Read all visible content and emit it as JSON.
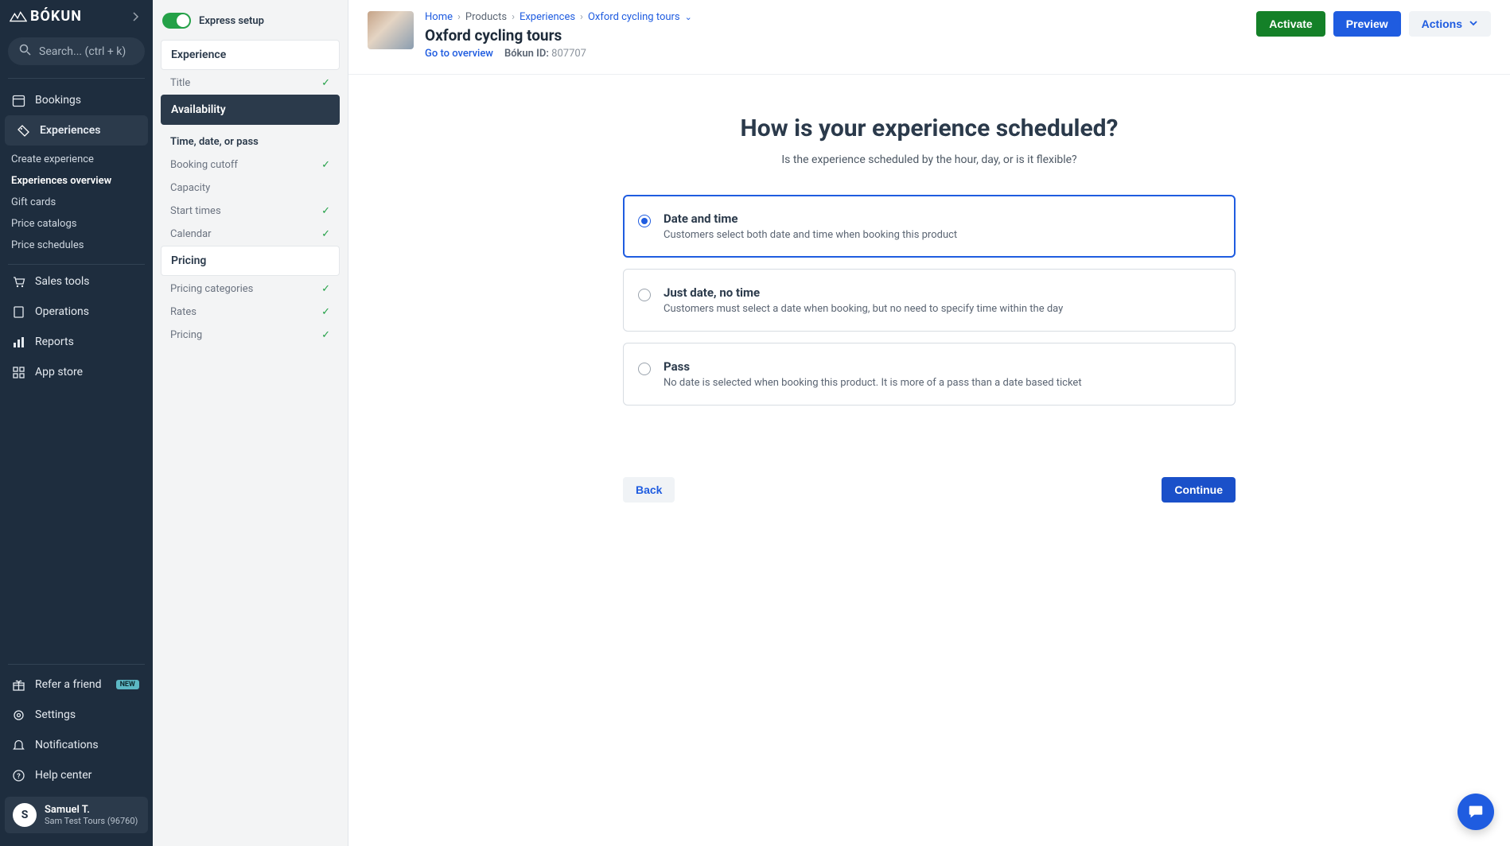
{
  "brand": "BÓKUN",
  "search": {
    "placeholder": "Search... (ctrl + k)"
  },
  "nav": {
    "bookings": "Bookings",
    "experiences": "Experiences",
    "experiences_sub": {
      "create": "Create experience",
      "overview": "Experiences overview",
      "gift": "Gift cards",
      "catalogs": "Price catalogs",
      "schedules": "Price schedules"
    },
    "sales": "Sales tools",
    "operations": "Operations",
    "reports": "Reports",
    "appstore": "App store",
    "refer": "Refer a friend",
    "refer_badge": "NEW",
    "settings": "Settings",
    "notifications": "Notifications",
    "help": "Help center"
  },
  "user": {
    "initial": "S",
    "name": "Samuel T.",
    "org": "Sam Test Tours (96760)"
  },
  "setup": {
    "toggle_label": "Express setup",
    "groups": {
      "experience": "Experience",
      "availability": "Availability",
      "pricing": "Pricing"
    },
    "items": {
      "title": "Title",
      "time_date_pass": "Time, date, or pass",
      "booking_cutoff": "Booking cutoff",
      "capacity": "Capacity",
      "start_times": "Start times",
      "calendar": "Calendar",
      "pricing_categories": "Pricing categories",
      "rates": "Rates",
      "pricing": "Pricing"
    }
  },
  "breadcrumb": {
    "home": "Home",
    "products": "Products",
    "experiences": "Experiences",
    "current": "Oxford cycling tours"
  },
  "header": {
    "title": "Oxford cycling tours",
    "overview_link": "Go to overview",
    "bokun_id_label": "Bókun ID:",
    "bokun_id": "807707"
  },
  "actions": {
    "activate": "Activate",
    "preview": "Preview",
    "actions": "Actions"
  },
  "question": {
    "title": "How is your experience scheduled?",
    "subtitle": "Is the experience scheduled by the hour, day, or is it flexible?"
  },
  "options": [
    {
      "title": "Date and time",
      "desc": "Customers select both date and time when booking this product",
      "selected": true
    },
    {
      "title": "Just date, no time",
      "desc": "Customers must select a date when booking, but no need to specify time within the day",
      "selected": false
    },
    {
      "title": "Pass",
      "desc": "No date is selected when booking this product. It is more of a pass than a date based ticket",
      "selected": false
    }
  ],
  "footer": {
    "back": "Back",
    "continue": "Continue"
  }
}
